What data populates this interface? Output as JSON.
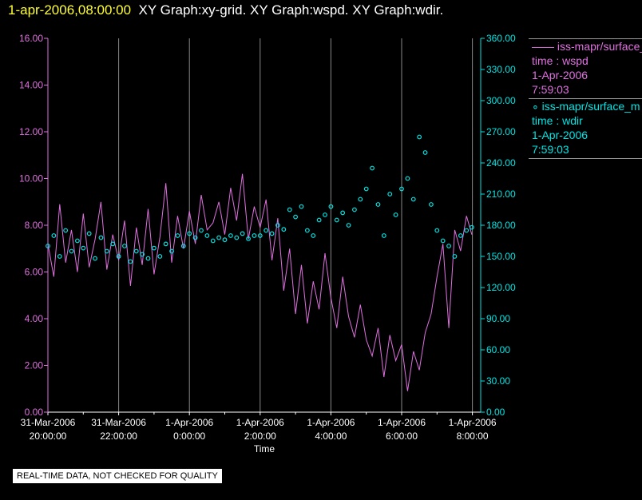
{
  "header": {
    "timestamp": "1-apr-2006,08:00:00",
    "graphs": "XY Graph:xy-grid.  XY Graph:wspd.  XY Graph:wdir."
  },
  "legend": [
    {
      "marker": "——",
      "name": "iss-mapr/surface_m",
      "lines": [
        "time : wspd",
        "1-Apr-2006",
        "7:59:03"
      ],
      "color": "#e070e0"
    },
    {
      "marker": "∘",
      "name": "iss-mapr/surface_m",
      "lines": [
        "time : wdir",
        "1-Apr-2006",
        "7:59:03"
      ],
      "color": "#00e5e5"
    }
  ],
  "note": "REAL-TIME DATA, NOT CHECKED FOR QUALITY",
  "chart_data": {
    "type": "line",
    "xlabel": "Time",
    "xlim": [
      "31-Mar-2006 20:00:00",
      "1-Apr-2006 08:14:00"
    ],
    "x_ticks": [
      [
        "31-Mar-2006",
        "20:00:00"
      ],
      [
        "31-Mar-2006",
        "22:00:00"
      ],
      [
        "1-Apr-2006",
        "0:00:00"
      ],
      [
        "1-Apr-2006",
        "2:00:00"
      ],
      [
        "1-Apr-2006",
        "4:00:00"
      ],
      [
        "1-Apr-2006",
        "6:00:00"
      ],
      [
        "1-Apr-2006",
        "8:00:00"
      ]
    ],
    "grid": "vertical",
    "y_left": {
      "lim": [
        0,
        16
      ],
      "ticks": [
        "0.00",
        "2.00",
        "4.00",
        "6.00",
        "8.00",
        "10.00",
        "12.00",
        "14.00",
        "16.00"
      ],
      "color": "#e070e0"
    },
    "y_right": {
      "lim": [
        0,
        360
      ],
      "ticks": [
        "0.00",
        "30.00",
        "60.00",
        "90.00",
        "120.00",
        "150.00",
        "180.00",
        "210.00",
        "240.00",
        "270.00",
        "300.00",
        "330.00",
        "360.00"
      ],
      "color": "#00e5e5"
    },
    "x": [
      "20:00",
      "20:10",
      "20:20",
      "20:30",
      "20:40",
      "20:50",
      "21:00",
      "21:10",
      "21:20",
      "21:30",
      "21:40",
      "21:50",
      "22:00",
      "22:10",
      "22:20",
      "22:30",
      "22:40",
      "22:50",
      "23:00",
      "23:10",
      "23:20",
      "23:30",
      "23:40",
      "23:50",
      "0:00",
      "0:10",
      "0:20",
      "0:30",
      "0:40",
      "0:50",
      "1:00",
      "1:10",
      "1:20",
      "1:30",
      "1:40",
      "1:50",
      "2:00",
      "2:10",
      "2:20",
      "2:30",
      "2:40",
      "2:50",
      "3:00",
      "3:10",
      "3:20",
      "3:30",
      "3:40",
      "3:50",
      "4:00",
      "4:10",
      "4:20",
      "4:30",
      "4:40",
      "4:50",
      "5:00",
      "5:10",
      "5:20",
      "5:30",
      "5:40",
      "5:50",
      "6:00",
      "6:10",
      "6:20",
      "6:30",
      "6:40",
      "6:50",
      "7:00",
      "7:10",
      "7:20",
      "7:30",
      "7:40",
      "7:50",
      "7:59"
    ],
    "series": [
      {
        "name": "wspd",
        "axis": "left",
        "style": "line",
        "color": "#e070e0",
        "values": [
          7.2,
          5.8,
          8.9,
          6.4,
          7.8,
          6.0,
          8.5,
          6.2,
          7.4,
          9.0,
          6.1,
          7.6,
          6.5,
          8.2,
          5.4,
          7.9,
          6.3,
          8.7,
          5.9,
          7.5,
          9.8,
          6.4,
          8.4,
          7.0,
          8.6,
          7.2,
          9.3,
          7.8,
          8.1,
          9.0,
          7.6,
          9.6,
          8.2,
          10.2,
          7.4,
          8.8,
          7.9,
          9.1,
          6.5,
          8.3,
          5.2,
          7.0,
          4.2,
          6.3,
          3.8,
          5.6,
          4.4,
          6.8,
          4.9,
          3.6,
          5.8,
          4.1,
          3.2,
          4.6,
          3.1,
          2.4,
          3.6,
          1.5,
          3.3,
          2.2,
          2.9,
          0.9,
          2.6,
          1.8,
          3.4,
          4.2,
          5.8,
          7.2,
          3.6,
          7.8,
          6.9,
          8.4,
          7.6
        ]
      },
      {
        "name": "wdir",
        "axis": "right",
        "style": "circles",
        "color": "#00e5e5",
        "values": [
          160,
          170,
          150,
          175,
          155,
          165,
          158,
          172,
          148,
          168,
          155,
          162,
          150,
          160,
          145,
          155,
          152,
          148,
          158,
          150,
          162,
          155,
          170,
          160,
          172,
          168,
          175,
          170,
          165,
          168,
          166,
          170,
          168,
          172,
          167,
          170,
          170,
          175,
          172,
          180,
          176,
          195,
          188,
          198,
          175,
          170,
          185,
          190,
          198,
          185,
          192,
          180,
          195,
          205,
          215,
          235,
          200,
          170,
          210,
          190,
          215,
          225,
          205,
          265,
          250,
          200,
          175,
          165,
          160,
          150,
          170,
          175,
          178
        ]
      }
    ]
  }
}
